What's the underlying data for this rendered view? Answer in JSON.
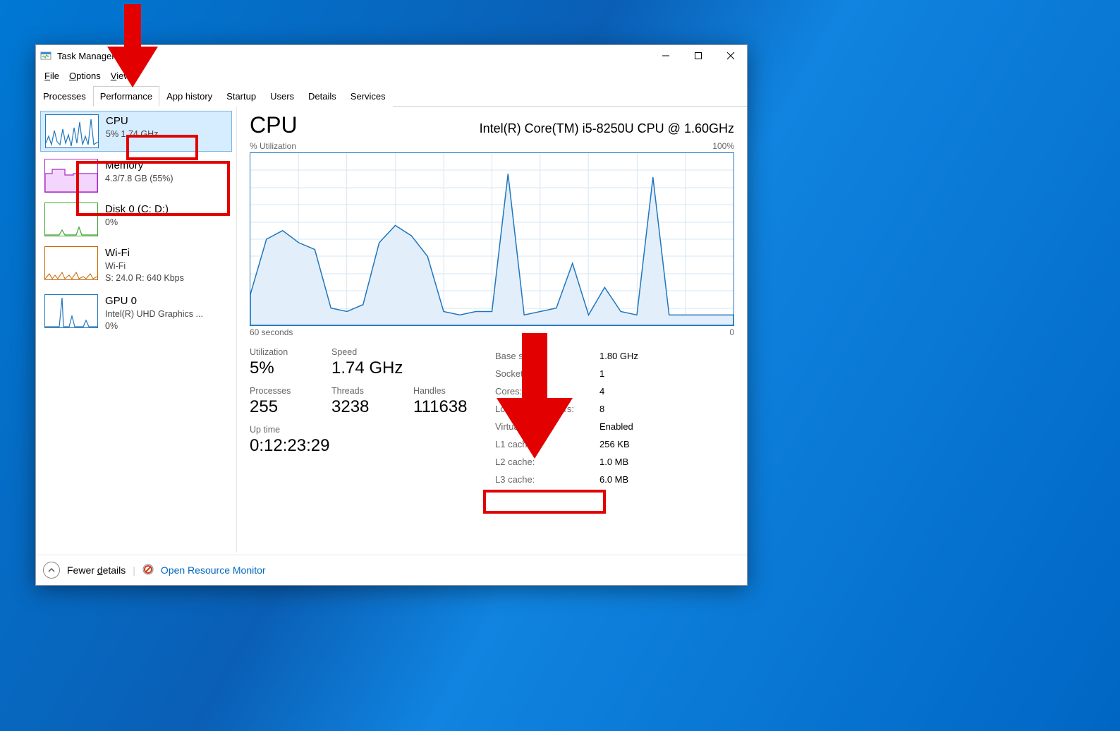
{
  "window": {
    "title": "Task Manager"
  },
  "menubar": [
    "File",
    "Options",
    "View"
  ],
  "tabs": [
    "Processes",
    "Performance",
    "App history",
    "Startup",
    "Users",
    "Details",
    "Services"
  ],
  "active_tab": 1,
  "sidebar": [
    {
      "name": "CPU",
      "sub": "5%  1.74 GHz",
      "selected": true,
      "color": "#2176bd"
    },
    {
      "name": "Memory",
      "sub": "4.3/7.8 GB (55%)",
      "color": "#a829c7"
    },
    {
      "name": "Disk 0 (C: D:)",
      "sub": "0%",
      "color": "#3fa535"
    },
    {
      "name": "Wi-Fi",
      "sub1": "Wi-Fi",
      "sub2": "S: 24.0  R: 640 Kbps",
      "color": "#c86400"
    },
    {
      "name": "GPU 0",
      "sub1": "Intel(R) UHD Graphics ...",
      "sub2": "0%",
      "color": "#2176bd"
    }
  ],
  "main": {
    "title": "CPU",
    "cpu_name": "Intel(R) Core(TM) i5-8250U CPU @ 1.60GHz",
    "chart_top_left": "% Utilization",
    "chart_top_right": "100%",
    "chart_bottom_left": "60 seconds",
    "chart_bottom_right": "0",
    "big": {
      "utilization_label": "Utilization",
      "utilization_value": "5%",
      "speed_label": "Speed",
      "speed_value": "1.74 GHz",
      "processes_label": "Processes",
      "processes_value": "255",
      "threads_label": "Threads",
      "threads_value": "3238",
      "handles_label": "Handles",
      "handles_value": "111638",
      "uptime_label": "Up time",
      "uptime_value": "0:12:23:29"
    },
    "table": [
      {
        "l": "Base speed:",
        "v": "1.80 GHz"
      },
      {
        "l": "Sockets:",
        "v": "1"
      },
      {
        "l": "Cores:",
        "v": "4"
      },
      {
        "l": "Logical processors:",
        "v": "8"
      },
      {
        "l": "Virtualization:",
        "v": "Enabled"
      },
      {
        "l": "L1 cache:",
        "v": "256 KB"
      },
      {
        "l": "L2 cache:",
        "v": "1.0 MB"
      },
      {
        "l": "L3 cache:",
        "v": "6.0 MB"
      }
    ]
  },
  "footer": {
    "fewer": "Fewer details",
    "link": "Open Resource Monitor"
  },
  "chart_data": {
    "type": "line",
    "title": "CPU % Utilization",
    "xlabel": "seconds",
    "ylabel": "% Utilization",
    "xlim": [
      60,
      0
    ],
    "ylim": [
      0,
      100
    ],
    "x": [
      60,
      58,
      56,
      54,
      52,
      50,
      48,
      46,
      44,
      42,
      40,
      38,
      36,
      34,
      32,
      30,
      28,
      26,
      24,
      22,
      20,
      18,
      16,
      14,
      12,
      10,
      8,
      6,
      4,
      2,
      0
    ],
    "values": [
      18,
      50,
      55,
      48,
      44,
      10,
      8,
      12,
      48,
      58,
      52,
      40,
      8,
      6,
      8,
      8,
      88,
      6,
      8,
      10,
      36,
      6,
      22,
      8,
      6,
      86,
      6,
      6,
      6,
      6,
      6
    ]
  }
}
